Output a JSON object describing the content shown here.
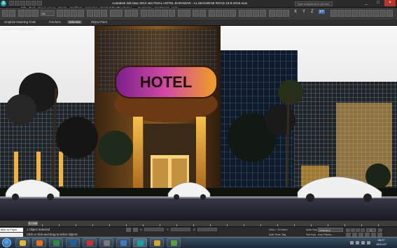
{
  "titlebar": {
    "app_icon": "3ds-max-logo-icon",
    "title": "Autodesk 3ds Max 2012 x64   FINAL  HOTEL BARAWAR   - AL MAGHRAB ROAD   15-8-2016.max",
    "search_placeholder": "Type a keyword or phrase",
    "window_controls": [
      "_",
      "□",
      "×"
    ]
  },
  "menu": [
    "Edit",
    "Tools",
    "Group",
    "Views",
    "Create",
    "Modifiers",
    "Animation",
    "Graph Editors",
    "Rendering",
    "Customize",
    "MAXScript",
    "Help"
  ],
  "toolbar": {
    "selection_filter": "All",
    "axis": [
      "X",
      "Y",
      "Z",
      "XY"
    ]
  },
  "ribbon": {
    "tabs": [
      "Graphite Modeling Tools",
      "Freeform",
      "Selection",
      "Object Paint"
    ],
    "active_tab": "Selection"
  },
  "viewport": {
    "label": "[+][Camera001][Realistic]",
    "sign_text": "HOTEL"
  },
  "timeline": {
    "position": "0 / 100",
    "ticks": [
      "0",
      "5",
      "10",
      "15",
      "20",
      "25",
      "30",
      "35",
      "40",
      "45",
      "50",
      "55",
      "60",
      "65",
      "70",
      "75",
      "80",
      "85",
      "90",
      "95",
      "100"
    ]
  },
  "statusbar": {
    "maxscript_line1": "Max to Physi",
    "maxscript_line2": "",
    "status_selected": "1 Object Selected",
    "prompt": "Click or click-and-drag to select objects",
    "x_label": "X:",
    "y_label": "Y:",
    "z_label": "Z:",
    "grid": "Grid = 10.0mm",
    "time_tag": "Add Time Tag",
    "auto_key": "Auto Key",
    "selected_dropdown": "Selected",
    "set_key": "Set Key",
    "key_filters": "Key Filters...",
    "frame": "0"
  },
  "taskbar": {
    "time": "06:27",
    "date": "16/11/17"
  },
  "colors": {
    "sign": "#b63aa8",
    "window_glow": "#f3b33c",
    "accent": "#19a3a8"
  }
}
